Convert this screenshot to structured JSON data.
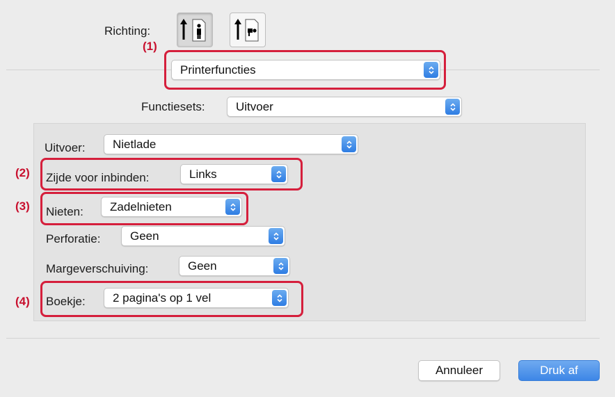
{
  "orientation": {
    "label": "Richting:"
  },
  "callouts": {
    "c1": "(1)",
    "c2": "(2)",
    "c3": "(3)",
    "c4": "(4)"
  },
  "panel_menu": {
    "value": "Printerfuncties"
  },
  "feature_sets": {
    "label": "Functiesets:",
    "value": "Uitvoer"
  },
  "fields": {
    "output": {
      "label": "Uitvoer:",
      "value": "Nietlade"
    },
    "binding_edge": {
      "label": "Zijde voor inbinden:",
      "value": "Links"
    },
    "staple": {
      "label": "Nieten:",
      "value": "Zadelnieten"
    },
    "punch": {
      "label": "Perforatie:",
      "value": "Geen"
    },
    "margin_shift": {
      "label": "Margeverschuiving:",
      "value": "Geen"
    },
    "booklet": {
      "label": "Boekje:",
      "value": "2 pagina's op 1 vel"
    }
  },
  "buttons": {
    "cancel": "Annuleer",
    "print": "Druk af"
  },
  "colors": {
    "callout": "#d51f3c",
    "accent": "#2e7de3",
    "window": "#ececec",
    "panel": "#e3e3e3"
  },
  "icons": [
    "portrait-orientation-icon",
    "landscape-orientation-icon",
    "popup-arrows-icon"
  ]
}
